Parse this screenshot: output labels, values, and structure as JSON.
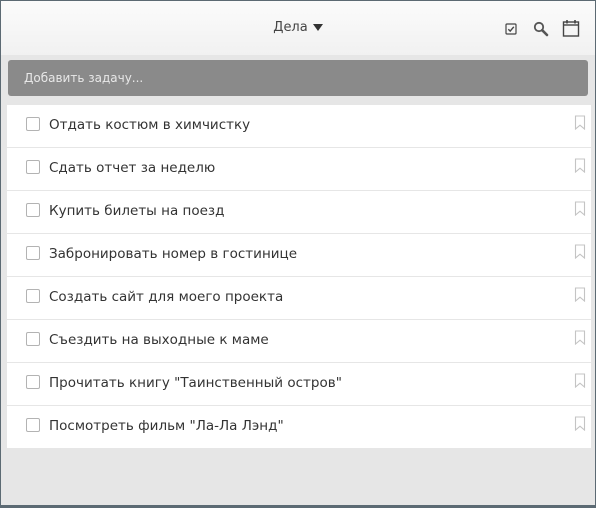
{
  "header": {
    "title": "Дела",
    "icons": [
      "checkbox-icon",
      "search-icon",
      "calendar-icon"
    ]
  },
  "add_task": {
    "placeholder": "Добавить задачу..."
  },
  "tasks": [
    {
      "text": "Отдать костюм в химчистку",
      "done": false,
      "starred": false
    },
    {
      "text": "Сдать отчет за неделю",
      "done": false,
      "starred": false
    },
    {
      "text": "Купить билеты на поезд",
      "done": false,
      "starred": false
    },
    {
      "text": "Забронировать номер в гостинице",
      "done": false,
      "starred": false
    },
    {
      "text": "Создать сайт для моего проекта",
      "done": false,
      "starred": false
    },
    {
      "text": "Съездить на выходные к маме",
      "done": false,
      "starred": false
    },
    {
      "text": "Прочитать книгу \"Таинственный остров\"",
      "done": false,
      "starred": false
    },
    {
      "text": "Посмотреть фильм \"Ла-Ла Лэнд\"",
      "done": false,
      "starred": false
    }
  ],
  "colors": {
    "header_bg": "#f3f3f3",
    "add_bar_bg": "#8a8a8a",
    "page_bg": "#e6e6e6",
    "row_bg": "#ffffff",
    "text": "#333333"
  }
}
